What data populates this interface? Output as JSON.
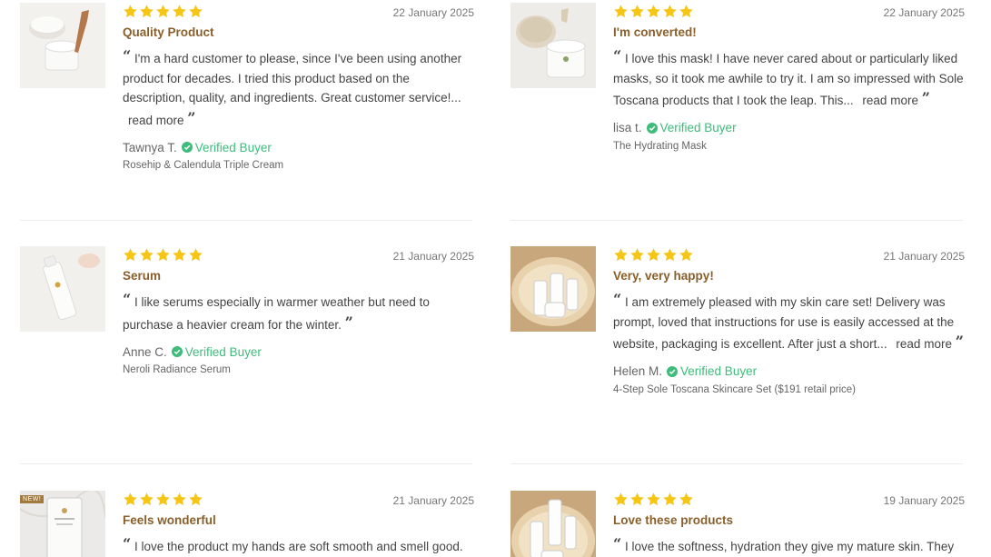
{
  "colors": {
    "star": "#f5c518",
    "title": "#8a5f2a",
    "verified": "#3ebc7b"
  },
  "icons": {
    "star": "star-icon",
    "verified": "check-badge-icon"
  },
  "common": {
    "verified_label": "Verified Buyer",
    "read_more": "read more",
    "open_quote": "“",
    "close_quote": "”",
    "new_badge": "NEW!"
  },
  "reviews": [
    {
      "rating": 5,
      "date": "22 January 2025",
      "title": "Quality Product",
      "text": "I'm a hard customer to please, since I've been using another product for decades. I tried this product based on the description, quality, and ingredients. Great customer service!...",
      "author": "Tawnya T.",
      "product": "Rosehip & Calendula Triple Cream"
    },
    {
      "rating": 5,
      "date": "22 January 2025",
      "title": "I'm converted!",
      "text": "I love this mask! I have never cared about or particularly liked masks, so it took me awhile to try it. I am so impressed with Sole Toscana products that I took the leap. This...",
      "author": "lisa t.",
      "product": "The Hydrating Mask"
    },
    {
      "rating": 5,
      "date": "21 January 2025",
      "title": "Serum",
      "text": "I like serums especially in warmer weather but need to purchase a heavier cream for the winter.",
      "author": "Anne C.",
      "product": "Neroli Radiance Serum"
    },
    {
      "rating": 5,
      "date": "21 January 2025",
      "title": "Very, very happy!",
      "text": "I am extremely pleased with my skin care set! Delivery was prompt, loved that instructions for use is easily accessed at the website, packaging is excellent. After just a short...",
      "author": "Helen M.",
      "product": "4-Step Sole Toscana Skincare Set ($191 retail price)"
    },
    {
      "rating": 5,
      "date": "21 January 2025",
      "title": "Feels wonderful",
      "text": "I love the product my hands are soft smooth and smell good.",
      "author": "",
      "product": ""
    },
    {
      "rating": 5,
      "date": "19 January 2025",
      "title": "Love these products",
      "text": "I love the softness, hydration they give my mature skin. They",
      "author": "",
      "product": ""
    }
  ]
}
